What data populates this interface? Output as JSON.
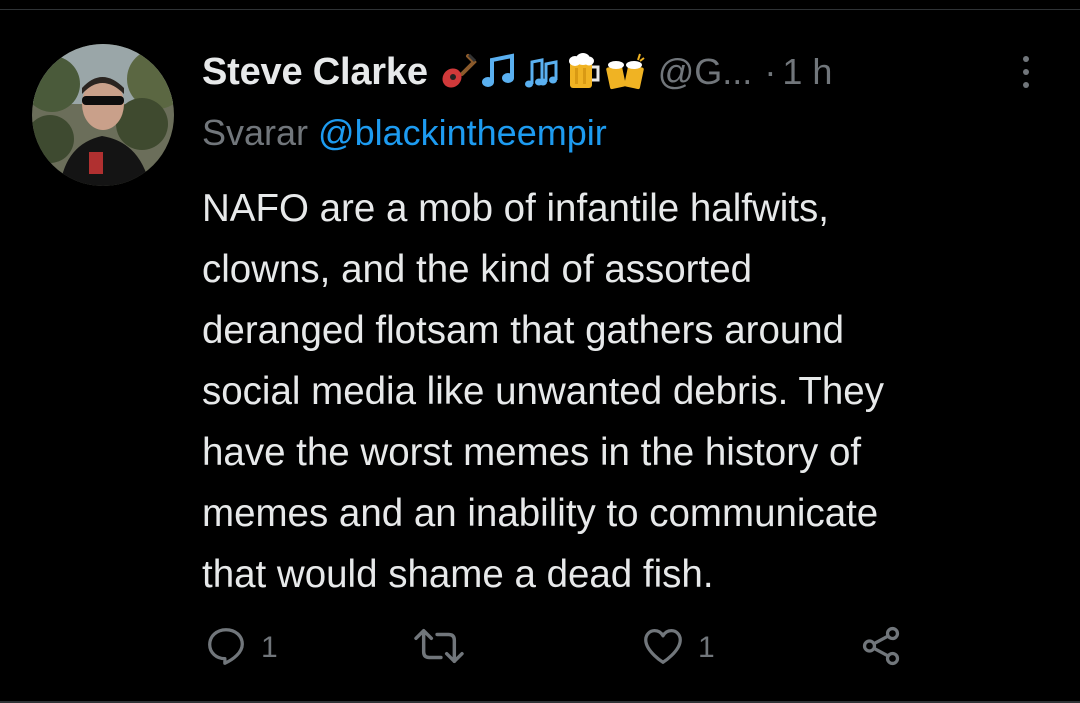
{
  "tweet": {
    "author_name": "Steve Clarke",
    "name_emojis": [
      "guitar-icon",
      "music-notes-icon",
      "music-notes-icon",
      "beer-mug-icon",
      "clinking-beers-icon"
    ],
    "handle": "@G...",
    "separator": "·",
    "time": "1 h",
    "reply_prefix": "Svarar",
    "reply_to": "@blackintheempir",
    "text_lines": [
      "NAFO are a mob of infantile halfwits,",
      "clowns, and the kind of assorted",
      "deranged flotsam that gathers around",
      "social media like unwanted debris. They",
      "have the worst memes in the history of",
      "memes and an inability to communicate",
      "that would shame a dead fish."
    ]
  },
  "actions": {
    "reply_count": "1",
    "retweet_count": "",
    "like_count": "1"
  },
  "colors": {
    "background": "#000000",
    "text": "#e7e9ea",
    "secondary": "#71767b",
    "link": "#1d9bf0"
  }
}
